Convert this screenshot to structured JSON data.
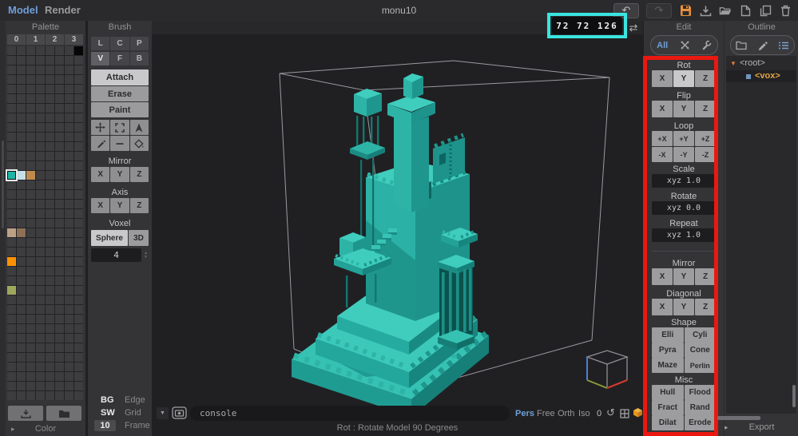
{
  "menubar": {
    "model": "Model",
    "render": "Render",
    "title": "monu10"
  },
  "toolbar": {
    "icons": [
      "undo",
      "redo",
      "save",
      "export",
      "open",
      "new-document",
      "copy",
      "delete"
    ]
  },
  "palette": {
    "title": "Palette",
    "tabs": [
      "0",
      "1",
      "2",
      "3"
    ],
    "grid": {
      "cols": 8,
      "rows": 37,
      "cells": [
        {
          "row": 0,
          "col": 7,
          "color": "#060606"
        },
        {
          "row": 13,
          "col": 0,
          "color": "#1fb3a6",
          "selected": true
        },
        {
          "row": 13,
          "col": 1,
          "color": "#c6e0e8"
        },
        {
          "row": 13,
          "col": 2,
          "color": "#c08a4f"
        },
        {
          "row": 19,
          "col": 0,
          "color": "#bca186"
        },
        {
          "row": 19,
          "col": 1,
          "color": "#8d7055"
        },
        {
          "row": 22,
          "col": 0,
          "color": "#ff9100"
        },
        {
          "row": 25,
          "col": 0,
          "color": "#9ea75d"
        }
      ]
    },
    "footer_icons": [
      "save-palette",
      "open-palette"
    ],
    "color_section_label": "Color"
  },
  "brush": {
    "title": "Brush",
    "modes": [
      [
        "L",
        "C",
        "P"
      ],
      [
        "V",
        "F",
        "B"
      ]
    ],
    "active_mode": "V",
    "actions": [
      "Attach",
      "Erase",
      "Paint"
    ],
    "active_action": "Attach",
    "tools": [
      "move",
      "marquee",
      "cursor",
      "pencil",
      "line",
      "fill"
    ],
    "mirror_label": "Mirror",
    "mirror_axes": [
      "X",
      "Y",
      "Z"
    ],
    "axis_label": "Axis",
    "axis_axes": [
      "X",
      "Y",
      "Z"
    ],
    "voxel_label": "Voxel",
    "voxel_modes": [
      "Sphere",
      "3D"
    ],
    "voxel_size": "4",
    "display_rows": [
      {
        "value": "BG",
        "label": "Edge"
      },
      {
        "value": "SW",
        "label": "Grid"
      },
      {
        "value": "10",
        "label": "Frame"
      }
    ]
  },
  "viewport": {
    "size_indicator": "72 72 126",
    "console_text": "console",
    "view_modes": [
      "Pers",
      "Free",
      "Orth",
      "Iso"
    ],
    "active_view_mode": "Pers",
    "ground_level": "0",
    "status_text": "Rot : Rotate Model 90 Degrees",
    "model_color": "#2cb9ab"
  },
  "edit": {
    "title": "Edit",
    "all_tab": "All",
    "rot": {
      "label": "Rot",
      "axes": [
        "X",
        "Y",
        "Z"
      ],
      "highlighted": "Y"
    },
    "flip": {
      "label": "Flip",
      "axes": [
        "X",
        "Y",
        "Z"
      ]
    },
    "loop": {
      "label": "Loop",
      "rows": [
        [
          "+X",
          "+Y",
          "+Z"
        ],
        [
          "-X",
          "-Y",
          "-Z"
        ]
      ]
    },
    "scale": {
      "label": "Scale",
      "value": "xyz 1.0"
    },
    "rotate": {
      "label": "Rotate",
      "value": "xyz 0.0"
    },
    "repeat": {
      "label": "Repeat",
      "value": "xyz 1.0"
    },
    "mirror": {
      "label": "Mirror",
      "axes": [
        "X",
        "Y",
        "Z"
      ]
    },
    "diagonal": {
      "label": "Diagonal",
      "axes": [
        "X",
        "Y",
        "Z"
      ]
    },
    "shape": {
      "label": "Shape",
      "rows": [
        [
          "Elli",
          "Cyli"
        ],
        [
          "Pyra",
          "Cone"
        ],
        [
          "Maze",
          "Perlin"
        ]
      ]
    },
    "misc": {
      "label": "Misc",
      "rows": [
        [
          "Hull",
          "Flood"
        ],
        [
          "Fract",
          "Rand"
        ],
        [
          "Dilat",
          "Erode"
        ]
      ]
    }
  },
  "outline": {
    "title": "Outline",
    "root_label": "<root>",
    "vox_label": "<vox>",
    "export_label": "Export"
  },
  "annotations": {
    "cyan_highlight": "#3ae4e0",
    "red_highlight": "#ea1810"
  },
  "colors": {
    "accent_blue": "#6f9fd8",
    "save_orange": "#e8913a",
    "model_teal": "#2cb9ab",
    "vox_orange": "#e2a33e"
  }
}
